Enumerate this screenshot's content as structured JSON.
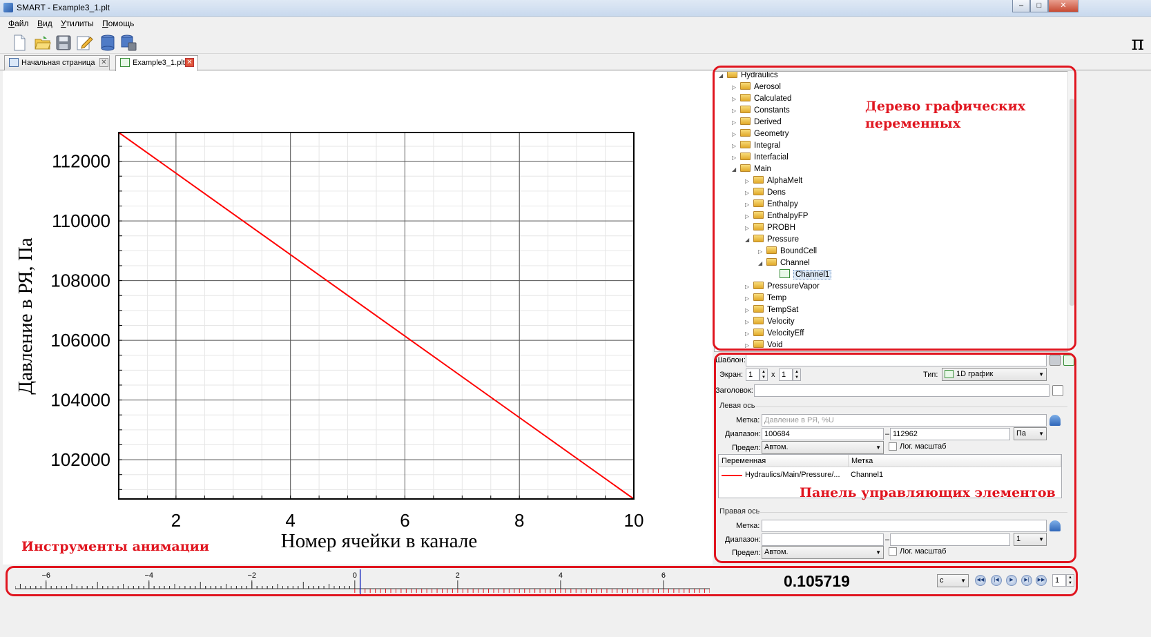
{
  "window": {
    "title": "SMART - Example3_1.plt",
    "minimize_label": "–",
    "maximize_label": "□",
    "close_label": "✕"
  },
  "menu": {
    "items": [
      "Файл",
      "Вид",
      "Утилиты",
      "Помощь"
    ]
  },
  "toolbar": {
    "icons": [
      "new-file-icon",
      "open-folder-icon",
      "save-icon",
      "edit-icon",
      "database-icon",
      "database-save-icon"
    ],
    "pi_label": "π"
  },
  "tabs": [
    {
      "label": "Начальная страница",
      "close": "✕",
      "active": false
    },
    {
      "label": "Example3_1.plt",
      "close": "✕",
      "active": true
    }
  ],
  "chart_data": {
    "type": "line",
    "xlabel": "Номер ячейки в канале",
    "ylabel": "Давление в РЯ, Па",
    "xlim": [
      1,
      10
    ],
    "ylim": [
      100684,
      112962
    ],
    "xticks": [
      2,
      4,
      6,
      8,
      10
    ],
    "yticks": [
      102000,
      104000,
      106000,
      108000,
      110000,
      112000
    ],
    "grid": true,
    "series": [
      {
        "color": "#ff0000",
        "x": [
          1,
          10
        ],
        "y": [
          112962,
          100684
        ]
      }
    ]
  },
  "tree": {
    "nodes": [
      {
        "label": "Hydraulics",
        "depth": 0,
        "expanded": true,
        "kind": "folder"
      },
      {
        "label": "Aerosol",
        "depth": 1,
        "expanded": false,
        "kind": "folder"
      },
      {
        "label": "Calculated",
        "depth": 1,
        "expanded": false,
        "kind": "folder"
      },
      {
        "label": "Constants",
        "depth": 1,
        "expanded": false,
        "kind": "folder"
      },
      {
        "label": "Derived",
        "depth": 1,
        "expanded": false,
        "kind": "folder"
      },
      {
        "label": "Geometry",
        "depth": 1,
        "expanded": false,
        "kind": "folder"
      },
      {
        "label": "Integral",
        "depth": 1,
        "expanded": false,
        "kind": "folder"
      },
      {
        "label": "Interfacial",
        "depth": 1,
        "expanded": false,
        "kind": "folder"
      },
      {
        "label": "Main",
        "depth": 1,
        "expanded": true,
        "kind": "folder"
      },
      {
        "label": "AlphaMelt",
        "depth": 2,
        "expanded": false,
        "kind": "folder"
      },
      {
        "label": "Dens",
        "depth": 2,
        "expanded": false,
        "kind": "folder"
      },
      {
        "label": "Enthalpy",
        "depth": 2,
        "expanded": false,
        "kind": "folder"
      },
      {
        "label": "EnthalpyFP",
        "depth": 2,
        "expanded": false,
        "kind": "folder"
      },
      {
        "label": "PROBH",
        "depth": 2,
        "expanded": false,
        "kind": "folder"
      },
      {
        "label": "Pressure",
        "depth": 2,
        "expanded": true,
        "kind": "folder"
      },
      {
        "label": "BoundCell",
        "depth": 3,
        "expanded": false,
        "kind": "folder"
      },
      {
        "label": "Channel",
        "depth": 3,
        "expanded": true,
        "kind": "folder"
      },
      {
        "label": "Channel1",
        "depth": 4,
        "expanded": null,
        "kind": "leaf",
        "selected": true
      },
      {
        "label": "PressureVapor",
        "depth": 2,
        "expanded": false,
        "kind": "folder"
      },
      {
        "label": "Temp",
        "depth": 2,
        "expanded": false,
        "kind": "folder"
      },
      {
        "label": "TempSat",
        "depth": 2,
        "expanded": false,
        "kind": "folder"
      },
      {
        "label": "Velocity",
        "depth": 2,
        "expanded": false,
        "kind": "folder"
      },
      {
        "label": "VelocityEff",
        "depth": 2,
        "expanded": false,
        "kind": "folder"
      },
      {
        "label": "Void",
        "depth": 2,
        "expanded": false,
        "kind": "folder"
      }
    ]
  },
  "controls": {
    "template_label": "Шаблон:",
    "screen_label": "Экран:",
    "screen_rows": "1",
    "screen_x": "x",
    "screen_cols": "1",
    "type_label": "Тип:",
    "type_value": "1D график",
    "heading_label": "Заголовок:",
    "left_axis": {
      "group": "Левая ось",
      "mark_label": "Метка:",
      "mark_placeholder": "Давление в РЯ, %U",
      "range_label": "Диапазон:",
      "range_min": "100684",
      "range_dash": "–",
      "range_max": "112962",
      "unit": "Па",
      "limit_label": "Предел:",
      "limit_value": "Автом.",
      "log_label": "Лог. масштаб"
    },
    "var_table": {
      "col_variable": "Переменная",
      "col_mark": "Метка",
      "row_variable": "Hydraulics/Main/Pressure/...",
      "row_mark": "Channel1",
      "row_color": "#ff0000"
    },
    "right_axis": {
      "group": "Правая ось",
      "mark_label": "Метка:",
      "range_label": "Диапазон:",
      "range_dash": "–",
      "unit": "1",
      "limit_label": "Предел:",
      "limit_value": "Автом.",
      "log_label": "Лог. масштаб"
    }
  },
  "annotations": {
    "tree_label": [
      "Дерево графических",
      "переменных"
    ],
    "controls_label": "Панель управляющих элементов",
    "anim_label": "Инструменты анимации",
    "color": "#e0151f"
  },
  "animation": {
    "ruler_labels": [
      "−6",
      "−4",
      "−2",
      "0",
      "2",
      "4",
      "6"
    ],
    "ruler_values": [
      -6,
      -4,
      -2,
      0,
      2,
      4,
      6
    ],
    "ruler_range": [
      -6.6,
      6.9
    ],
    "current_value": "0.105719",
    "time_unit": "c",
    "step_value": "1"
  }
}
